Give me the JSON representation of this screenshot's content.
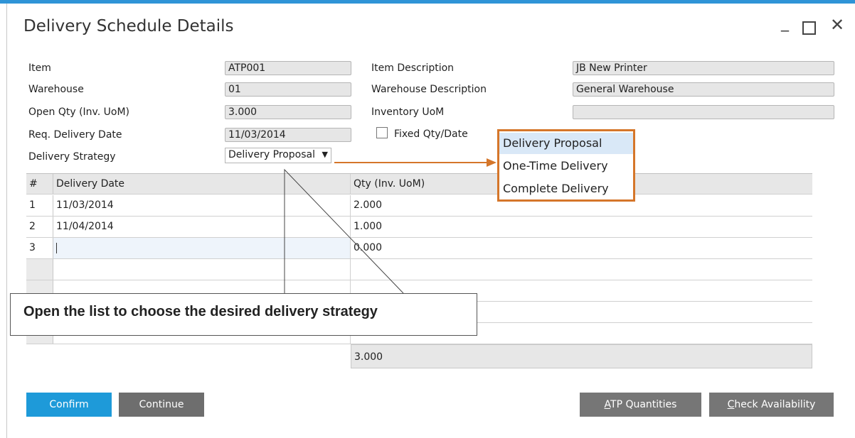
{
  "window": {
    "title": "Delivery Schedule Details",
    "minimize": "_",
    "close": "✕"
  },
  "header": {
    "item_label": "Item",
    "item_value": "ATP001",
    "item_desc_label": "Item Description",
    "item_desc_value": "JB New Printer",
    "warehouse_label": "Warehouse",
    "warehouse_value": "01",
    "warehouse_desc_label": "Warehouse Description",
    "warehouse_desc_value": "General Warehouse",
    "open_qty_label": "Open Qty (Inv. UoM)",
    "open_qty_value": "3.000",
    "inventory_uom_label": "Inventory UoM",
    "inventory_uom_value": "",
    "req_date_label": "Req. Delivery Date",
    "req_date_value": "11/03/2014",
    "fixed_qty_label": "Fixed Qty/Date",
    "fixed_qty_checked": false,
    "strategy_label": "Delivery Strategy",
    "strategy_value": "Delivery Proposal"
  },
  "dropdown": {
    "options": [
      "Delivery Proposal",
      "One-Time Delivery",
      "Complete Delivery"
    ],
    "selected_index": 0
  },
  "table": {
    "col_num": "#",
    "col_date": "Delivery Date",
    "col_qty": "Qty (Inv. UoM)",
    "rows": [
      {
        "num": "1",
        "date": "11/03/2014",
        "qty": "2.000"
      },
      {
        "num": "2",
        "date": "11/04/2014",
        "qty": "1.000"
      },
      {
        "num": "3",
        "date": "",
        "qty": "0.000"
      }
    ],
    "total_qty": "3.000"
  },
  "callout": {
    "text": "Open the list to choose the desired delivery strategy"
  },
  "buttons": {
    "confirm": "Confirm",
    "continue": "Continue",
    "atp_prefix": "A",
    "atp_rest": "TP Quantities",
    "check_prefix": "C",
    "check_rest": "heck Availability"
  },
  "colors": {
    "accent": "#2f94d7",
    "confirm_button": "#1e9ad9",
    "grey_button": "#767676",
    "highlight_border": "#d5762a",
    "selected_option": "#d9e8f7"
  }
}
